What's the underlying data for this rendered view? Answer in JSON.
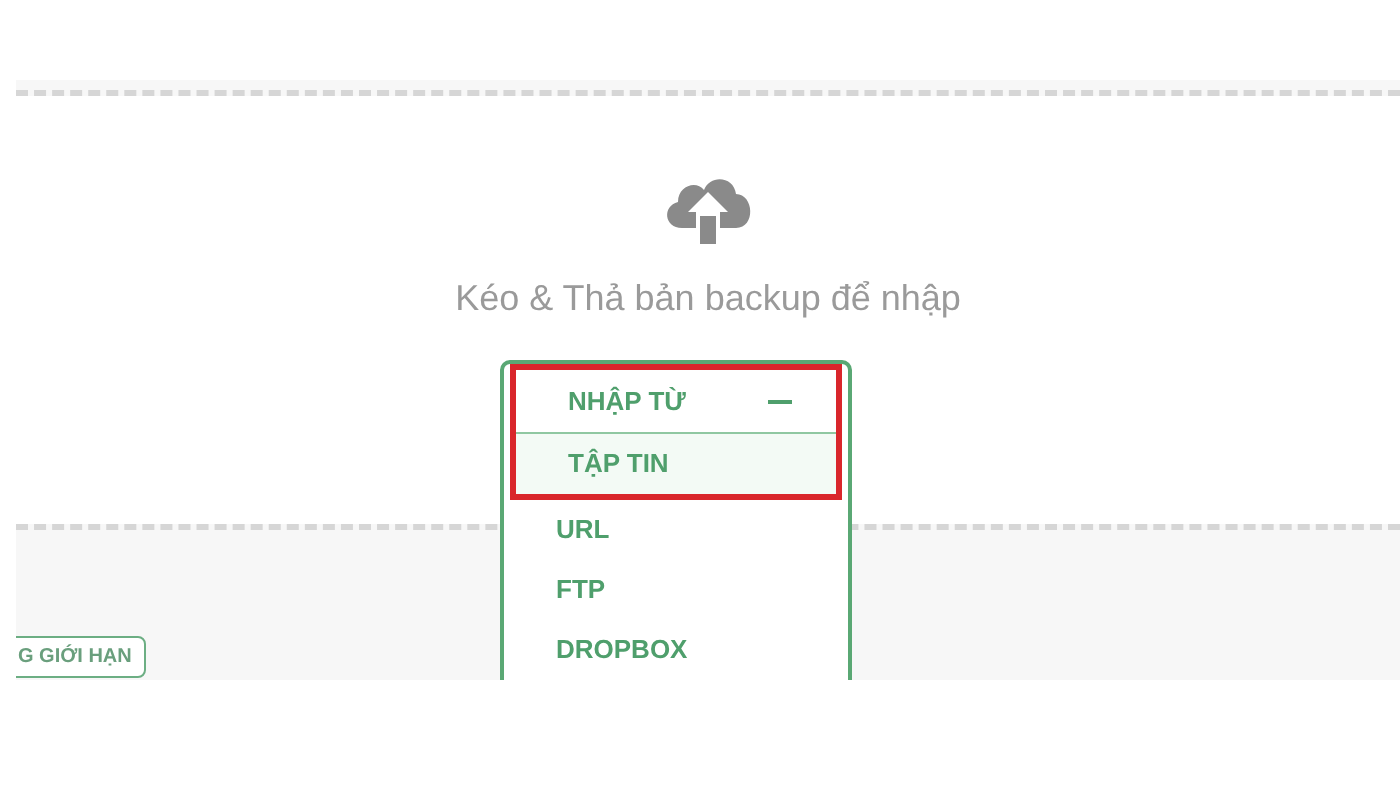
{
  "dropzone": {
    "message": "Kéo & Thả bản backup để nhập"
  },
  "import_menu": {
    "title": "NHẬP TỪ",
    "expanded": true,
    "highlighted": true,
    "items": [
      {
        "label": "TẬP TIN",
        "selected": true
      },
      {
        "label": "URL",
        "selected": false
      },
      {
        "label": "FTP",
        "selected": false
      },
      {
        "label": "DROPBOX",
        "selected": false
      }
    ]
  },
  "badge": {
    "label": "G GIỚI HẠN"
  }
}
